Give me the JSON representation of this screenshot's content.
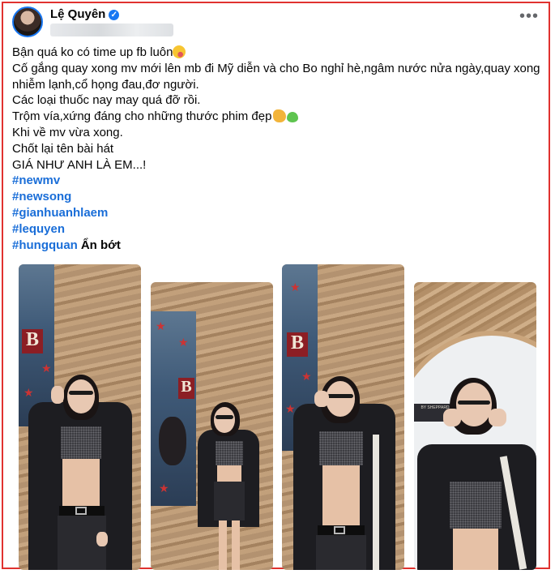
{
  "post": {
    "author": "Lệ Quyên",
    "verified_icon": "verified-badge-icon",
    "more_icon": "more-options-icon",
    "lines": [
      "Bận quá ko có time up fb luôn",
      "Cố gắng quay xong mv mới lên mb đi Mỹ diễn và cho Bo nghỉ hè,ngâm nước nửa ngày,quay xong",
      "nhiễm lạnh,cổ họng đau,đơ người.",
      "Các loại thuốc nay may quá đỡ rồi.",
      "Trộm vía,xứng đáng cho những thước phim đẹp",
      "Khi về mv vừa xong.",
      "Chốt lại tên bài hát",
      "GIÁ NHƯ ANH LÀ EM...!"
    ],
    "hashtags": [
      "#newmv",
      "#newsong",
      "#gianhuanhlaem",
      "#lequyen",
      "#hungquan"
    ],
    "see_less": "Ẩn bớt"
  },
  "photos": [
    {
      "alt": "photo-1"
    },
    {
      "alt": "photo-2"
    },
    {
      "alt": "photo-3"
    },
    {
      "alt": "photo-4",
      "sign_text": "BY SHEPPARD"
    }
  ],
  "colors": {
    "accent": "#1877f2",
    "hashtag": "#1a6ed8",
    "frame": "#e0322f"
  }
}
